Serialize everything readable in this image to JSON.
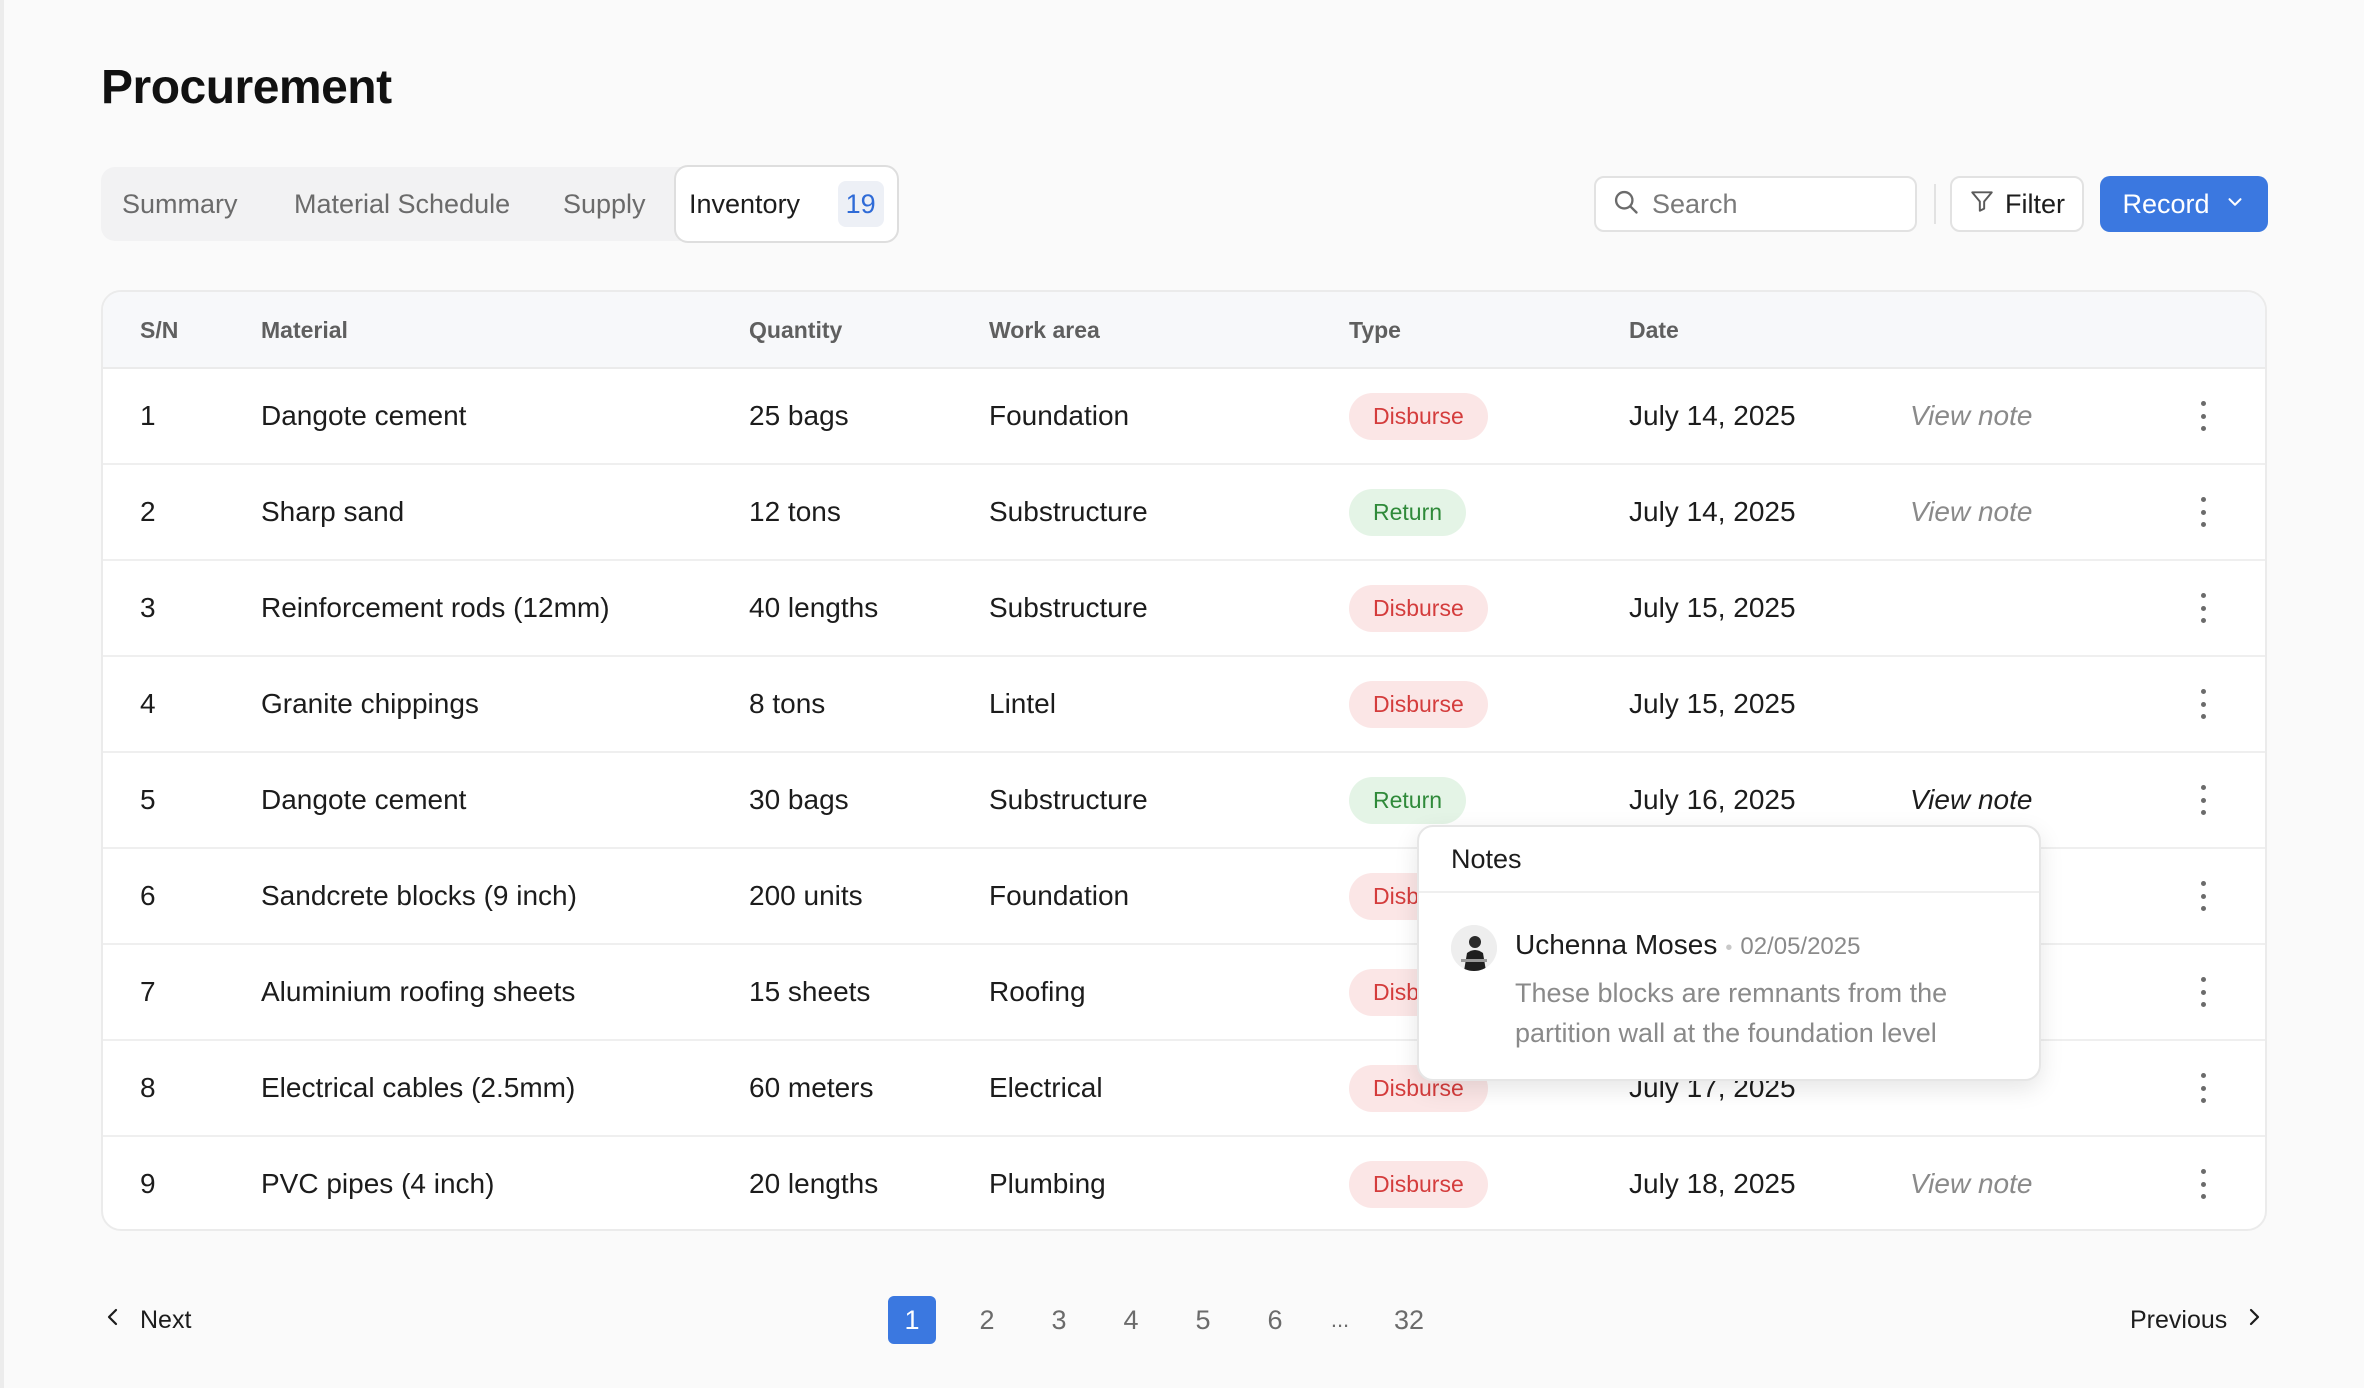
{
  "page": {
    "title": "Procurement"
  },
  "tabs": [
    {
      "label": "Summary"
    },
    {
      "label": "Material Schedule"
    },
    {
      "label": "Supply"
    },
    {
      "label": "Inventory",
      "count": "19",
      "active": true
    }
  ],
  "toolbar": {
    "search_placeholder": "Search",
    "filter_label": "Filter",
    "record_label": "Record"
  },
  "table": {
    "columns": [
      "S/N",
      "Material",
      "Quantity",
      "Work area",
      "Type",
      "Date"
    ],
    "rows": [
      {
        "sn": "1",
        "material": "Dangote cement",
        "quantity": "25 bags",
        "work_area": "Foundation",
        "type": "Disburse",
        "date": "July 14, 2025",
        "note": "View note"
      },
      {
        "sn": "2",
        "material": "Sharp sand",
        "quantity": "12 tons",
        "work_area": "Substructure",
        "type": "Return",
        "date": "July 14, 2025",
        "note": "View note"
      },
      {
        "sn": "3",
        "material": "Reinforcement rods (12mm)",
        "quantity": "40 lengths",
        "work_area": "Substructure",
        "type": "Disburse",
        "date": "July 15, 2025",
        "note": ""
      },
      {
        "sn": "4",
        "material": "Granite chippings",
        "quantity": "8 tons",
        "work_area": "Lintel",
        "type": "Disburse",
        "date": "July 15, 2025",
        "note": ""
      },
      {
        "sn": "5",
        "material": "Dangote cement",
        "quantity": "30 bags",
        "work_area": "Substructure",
        "type": "Return",
        "date": "July 16, 2025",
        "note": "View note"
      },
      {
        "sn": "6",
        "material": "Sandcrete blocks (9 inch)",
        "quantity": "200 units",
        "work_area": "Foundation",
        "type": "Disb",
        "date": "",
        "note": ""
      },
      {
        "sn": "7",
        "material": "Aluminium roofing sheets",
        "quantity": "15 sheets",
        "work_area": "Roofing",
        "type": "Disb",
        "date": "",
        "note": ""
      },
      {
        "sn": "8",
        "material": "Electrical cables (2.5mm)",
        "quantity": "60 meters",
        "work_area": "Electrical",
        "type": "Disburse",
        "date": "July 17, 2025",
        "note": ""
      },
      {
        "sn": "9",
        "material": "PVC pipes (4 inch)",
        "quantity": "20 lengths",
        "work_area": "Plumbing",
        "type": "Disburse",
        "date": "July 18, 2025",
        "note": "View note"
      }
    ]
  },
  "notes_popover": {
    "title": "Notes",
    "author": "Uchenna Moses",
    "date": "02/05/2025",
    "text": "These blocks are remnants from the partition wall at the foundation level"
  },
  "pagination": {
    "prev_label": "Next",
    "next_label": "Previous",
    "pages": [
      "1",
      "2",
      "3",
      "4",
      "5",
      "6",
      "...",
      "32"
    ],
    "current": "1"
  },
  "colors": {
    "accent": "#3b78e0",
    "disburse_bg": "#fbe6e6",
    "disburse_text": "#d43c3c",
    "return_bg": "#e4f4e6",
    "return_text": "#2f8a3a"
  }
}
